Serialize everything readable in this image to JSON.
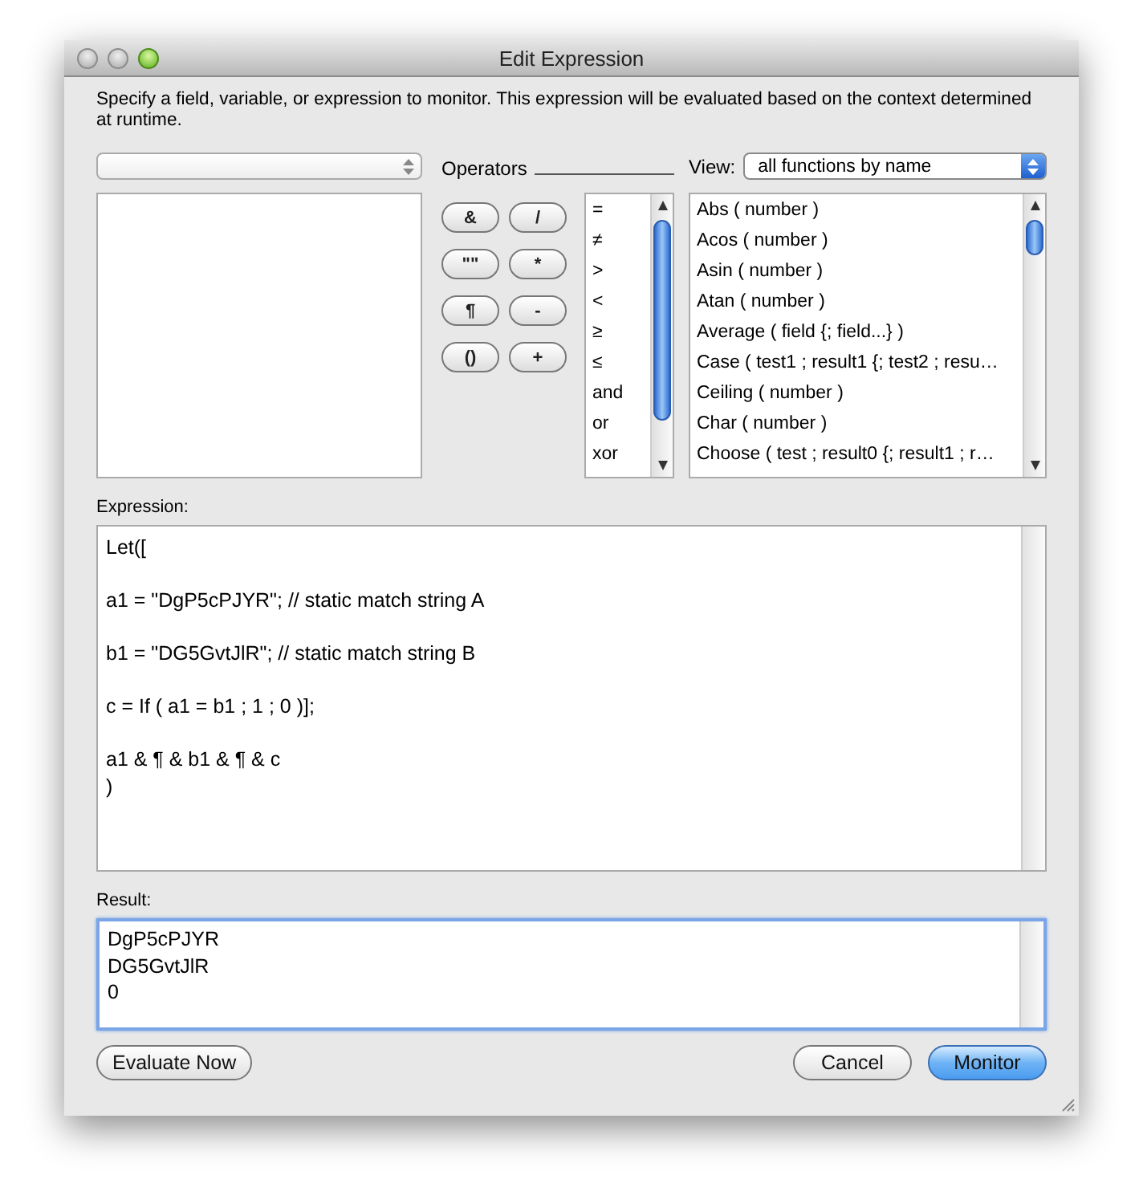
{
  "window": {
    "title": "Edit Expression"
  },
  "description": "Specify a field, variable, or expression to monitor. This expression will be evaluated based on the context determined at runtime.",
  "operators_label": "Operators",
  "operator_buttons": [
    "&",
    "/",
    "\"\"",
    "*",
    "¶",
    "-",
    "()",
    "+"
  ],
  "operator_list": [
    "=",
    "≠",
    ">",
    "<",
    "≥",
    "≤",
    "and",
    "or",
    "xor"
  ],
  "view": {
    "label": "View:",
    "value": "all functions by name"
  },
  "functions": [
    "Abs ( number )",
    "Acos ( number )",
    "Asin ( number )",
    "Atan ( number )",
    "Average ( field {; field...} )",
    "Case ( test1 ; result1 {; test2 ; resu…",
    "Ceiling ( number )",
    "Char ( number )",
    "Choose ( test ; result0 {; result1 ; r…"
  ],
  "expression": {
    "label": "Expression:",
    "value": "Let([\n\na1 = \"DgP5cPJYR\"; // static match string A\n\nb1 = \"DG5GvtJlR\"; // static match string B\n\nc = If ( a1 = b1 ; 1 ; 0 )];\n\na1 & ¶ & b1 & ¶ & c\n)"
  },
  "result": {
    "label": "Result:",
    "value": "DgP5cPJYR\nDG5GvtJlR\n0"
  },
  "buttons": [
    {
      "label": "Evaluate Now",
      "kind": "plain"
    },
    {
      "label": "Cancel",
      "kind": "plain"
    },
    {
      "label": "Monitor",
      "kind": "default"
    }
  ]
}
